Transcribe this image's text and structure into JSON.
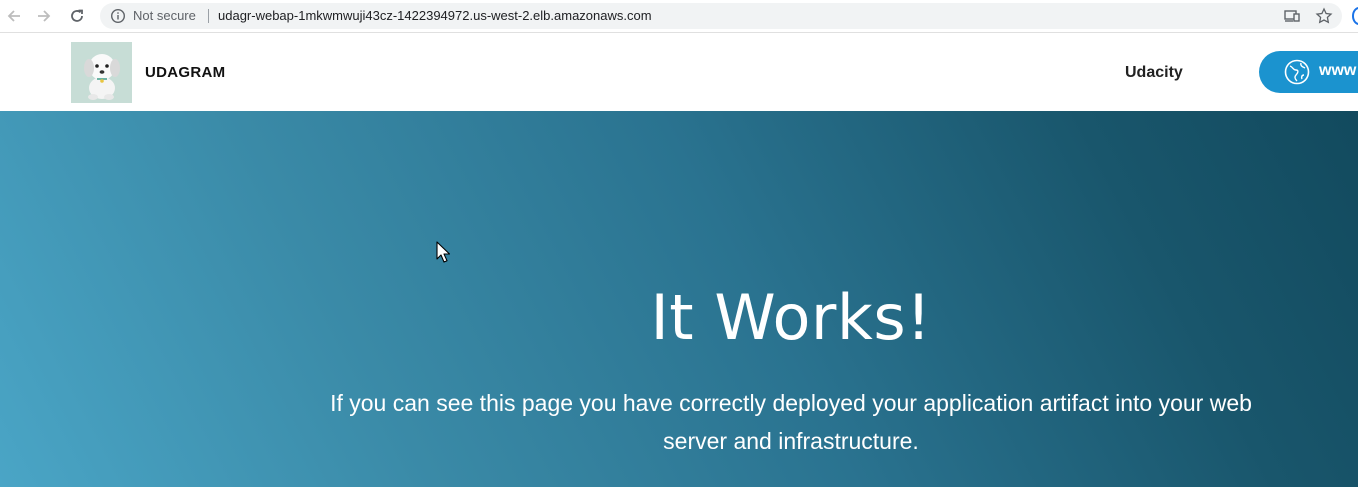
{
  "browser": {
    "security_label": "Not secure",
    "url": "udagr-webap-1mkwmwuji43cz-1422394972.us-west-2.elb.amazonaws.com"
  },
  "header": {
    "brand": "UDAGRAM",
    "nav_link": "Udacity",
    "cta_label": "www"
  },
  "hero": {
    "title": "It Works!",
    "subtitle": "If you can see this page you have correctly deployed your application artifact into your web server and infrastructure."
  },
  "colors": {
    "cta": "#1b93cf",
    "hero_start": "#4aa5c6",
    "hero_end": "#124a5e"
  },
  "icons": [
    "back-arrow-icon",
    "forward-arrow-icon",
    "reload-icon",
    "info-icon",
    "cast-icon",
    "star-icon",
    "globe-icon",
    "mouse-cursor-icon"
  ]
}
